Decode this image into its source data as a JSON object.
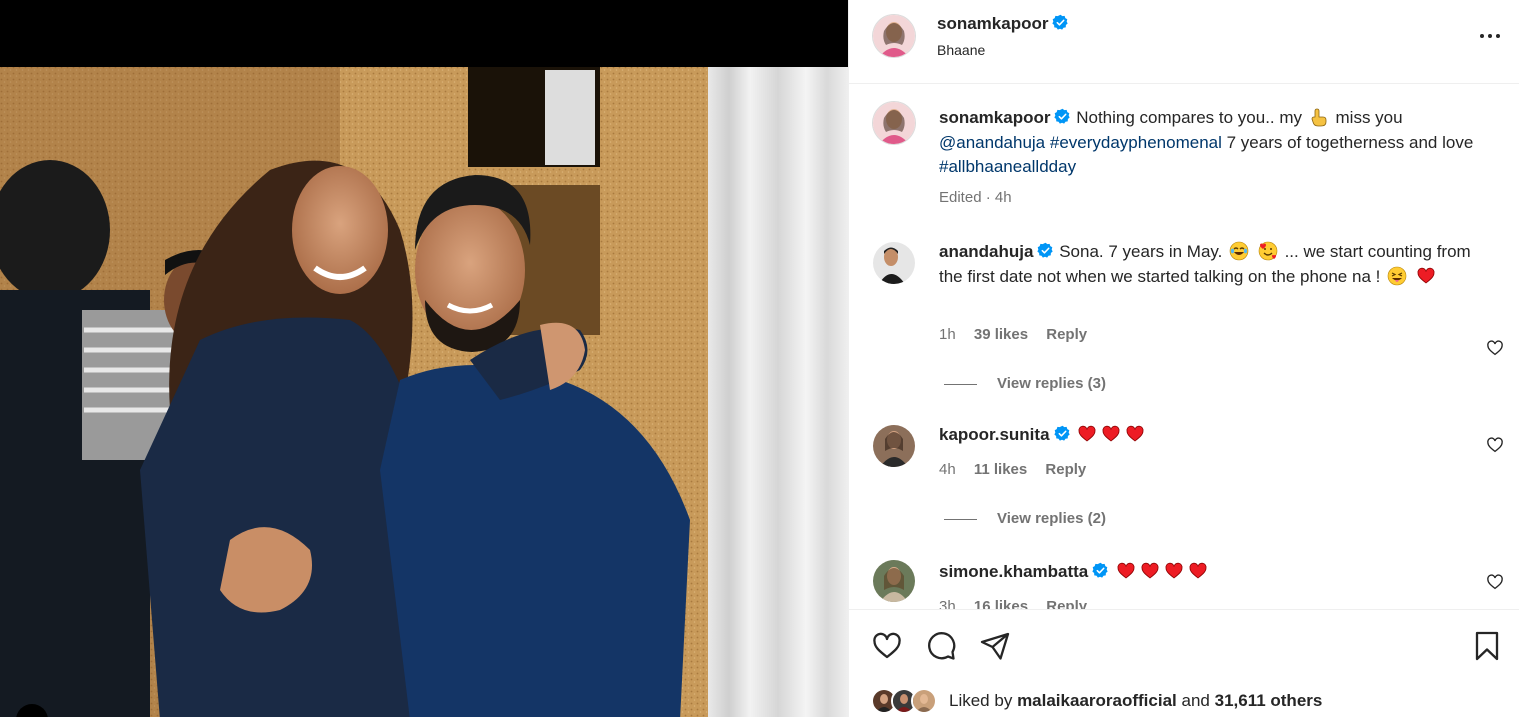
{
  "post": {
    "author": "sonamkapoor",
    "location": "Bhaane",
    "verified": true,
    "caption": {
      "text_before": "Nothing compares to you.. my",
      "emoji_1": "pointing-hand-emoji",
      "text_after": "miss you",
      "mention": "@anandahuja",
      "hashtag_1": "#everydayphenomenal",
      "text_mid": "7 years of togetherness and love",
      "hashtag_2": "#allbhaanealldday"
    },
    "caption_meta": "Edited · 4h"
  },
  "comments": [
    {
      "user": "anandahuja",
      "verified": true,
      "text_1": "Sona. 7 years in May.",
      "text_2": "... we start counting from the first date not when we started talking on the phone na !",
      "time": "1h",
      "likes": "39 likes",
      "reply": "Reply",
      "view_replies": "View replies (3)"
    },
    {
      "user": "kapoor.sunita",
      "verified": true,
      "time": "4h",
      "likes": "11 likes",
      "reply": "Reply",
      "view_replies": "View replies (2)"
    },
    {
      "user": "simone.khambatta",
      "verified": true,
      "time": "3h",
      "likes": "16 likes",
      "reply": "Reply"
    }
  ],
  "likes": {
    "prefix": "Liked by",
    "user": "malaikaaroraofficial",
    "joiner": "and",
    "others": "31,611 others"
  },
  "colors": {
    "verified": "#0095f6",
    "heart_red": "#ed1c24",
    "link": "#00376b",
    "muted": "#737373"
  }
}
